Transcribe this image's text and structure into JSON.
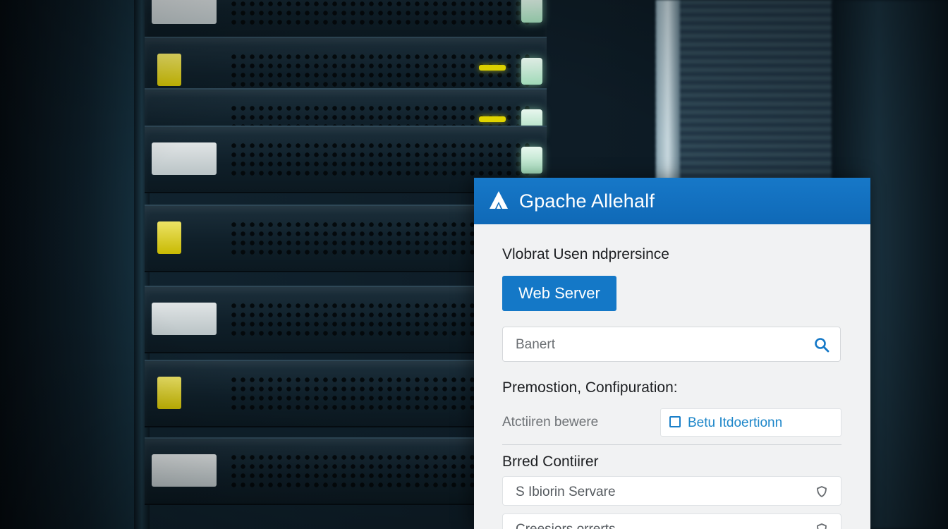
{
  "app": {
    "title": "Gpache Allehalf"
  },
  "dialog": {
    "heading": "Vlobrat Usen ndprersince",
    "primary_button": "Web Server",
    "search": {
      "placeholder": "Banert"
    },
    "configuration": {
      "heading": "Premostion, Confipuration:",
      "row_label": "Atctiiren bewere",
      "checkbox_label": "Betu Itdoertionn",
      "checked": false
    },
    "container": {
      "heading": "Brred Contiirer",
      "select_1_value": "S Ibiorin Servare",
      "select_2_value": "Creesiors orrerts"
    }
  },
  "colors": {
    "header_blue": "#1778c8",
    "button_blue": "#1478c7",
    "link_blue": "#1d86c9",
    "panel_bg": "#f1f2f3"
  },
  "icons": {
    "logo": "triangle-logo-icon",
    "search": "search-icon",
    "select": "shield-icon"
  }
}
